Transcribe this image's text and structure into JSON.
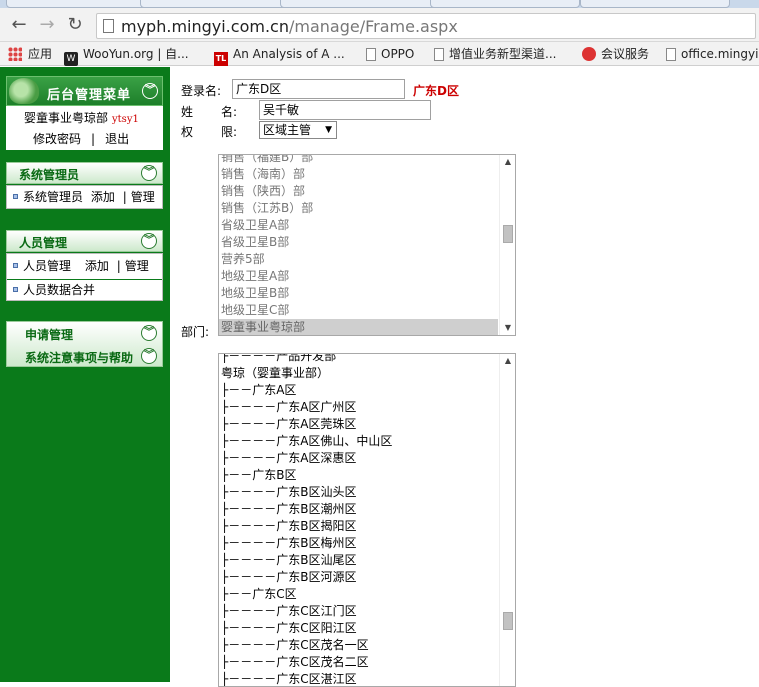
{
  "browser": {
    "url_host": "myph.mingyi.com.cn",
    "url_path": "/manage/Frame.aspx",
    "bookmarks": [
      "应用",
      "WooYun.org | 自...",
      "An Analysis of A ...",
      "OPPO",
      "增值业务新型渠道...",
      "会议服务",
      "office.mingyi."
    ]
  },
  "sidebar": {
    "title": "后台管理菜单",
    "dept": "婴童事业粤琼部",
    "user_id": "ytsy1",
    "change_password": "修改密码",
    "separator": "|",
    "logout": "退出",
    "sys_admin": {
      "title": "系统管理员",
      "item_label": "系统管理员",
      "add": "添加",
      "sep": "|",
      "manage": "管理"
    },
    "personnel": {
      "title": "人员管理",
      "item_label": "人员管理",
      "add": "添加",
      "sep": "|",
      "manage": "管理",
      "merge": "人员数据合并"
    },
    "apply_title": "申请管理",
    "help_title": "系统注意事项与帮助"
  },
  "form": {
    "login_label": "登录名:",
    "login_value": "广东D区",
    "login_hint": "广东D区",
    "name_label_a": "姓",
    "name_label_b": "名:",
    "name_value": "吴千敏",
    "role_label_a": "权",
    "role_label_b": "限:",
    "role_value": "区域主管",
    "dept_label": "部门:"
  },
  "dept_list": {
    "items": [
      "销售（福建B）部",
      "销售（海南）部",
      "销售（陕西）部",
      "销售（江苏B）部",
      "省级卫星A部",
      "省级卫星B部",
      "营养5部",
      "地级卫星A部",
      "地级卫星B部",
      "地级卫星C部",
      "婴童事业粤琼部"
    ],
    "selected_index": 10
  },
  "region_tree": {
    "items": [
      "├－－－－产品开发部",
      "粤琼（婴童事业部）",
      "├－－广东A区",
      "├－－－－广东A区广州区",
      "├－－－－广东A区莞珠区",
      "├－－－－广东A区佛山、中山区",
      "├－－－－广东A区深惠区",
      "├－－广东B区",
      "├－－－－广东B区汕头区",
      "├－－－－广东B区潮州区",
      "├－－－－广东B区揭阳区",
      "├－－－－广东B区梅州区",
      "├－－－－广东B区汕尾区",
      "├－－－－广东B区河源区",
      "├－－广东C区",
      "├－－－－广东C区江门区",
      "├－－－－广东C区阳江区",
      "├－－－－广东C区茂名一区",
      "├－－－－广东C区茂名二区",
      "├－－－－广东C区湛江区"
    ]
  }
}
